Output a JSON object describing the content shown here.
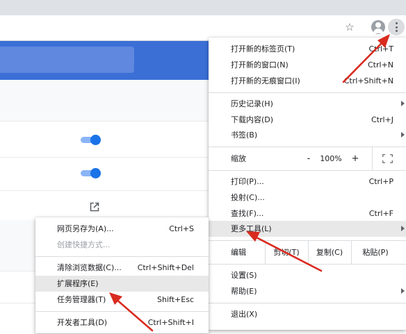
{
  "toolbar": {
    "star_icon": "star-icon",
    "star_glyph": "☆",
    "avatar_icon": "avatar-icon",
    "menu_icon": "more-vert-icon"
  },
  "page": {
    "header_color": "#3b6fd6",
    "toggle_color": "#1a73e8"
  },
  "main_menu": {
    "new_tab": {
      "label": "打开新的标签页(T)",
      "shortcut": "Ctrl+T"
    },
    "new_window": {
      "label": "打开新的窗口(N)",
      "shortcut": "Ctrl+N"
    },
    "new_incognito": {
      "label": "打开新的无痕窗口(I)",
      "shortcut": "Ctrl+Shift+N"
    },
    "history": {
      "label": "历史记录(H)"
    },
    "downloads": {
      "label": "下载内容(D)",
      "shortcut": "Ctrl+J"
    },
    "bookmarks": {
      "label": "书签(B)"
    },
    "zoom": {
      "label": "缩放",
      "minus": "-",
      "value": "100%",
      "plus": "+"
    },
    "print": {
      "label": "打印(P)...",
      "shortcut": "Ctrl+P"
    },
    "cast": {
      "label": "投射(C)..."
    },
    "find": {
      "label": "查找(F)...",
      "shortcut": "Ctrl+F"
    },
    "more_tools": {
      "label": "更多工具(L)"
    },
    "edit": {
      "label": "编辑",
      "cut": "剪切(T)",
      "copy": "复制(C)",
      "paste": "粘贴(P)"
    },
    "settings": {
      "label": "设置(S)"
    },
    "help": {
      "label": "帮助(E)"
    },
    "exit": {
      "label": "退出(X)"
    }
  },
  "sub_menu": {
    "save_page": {
      "label": "网页另存为(A)...",
      "shortcut": "Ctrl+S"
    },
    "create_shortcut": {
      "label": "创建快捷方式..."
    },
    "clear_data": {
      "label": "清除浏览数据(C)...",
      "shortcut": "Ctrl+Shift+Del"
    },
    "extensions": {
      "label": "扩展程序(E)"
    },
    "task_manager": {
      "label": "任务管理器(T)",
      "shortcut": "Shift+Esc"
    },
    "dev_tools": {
      "label": "开发者工具(D)",
      "shortcut": "Ctrl+Shift+I"
    }
  },
  "annotation_color": "#d92b1f"
}
